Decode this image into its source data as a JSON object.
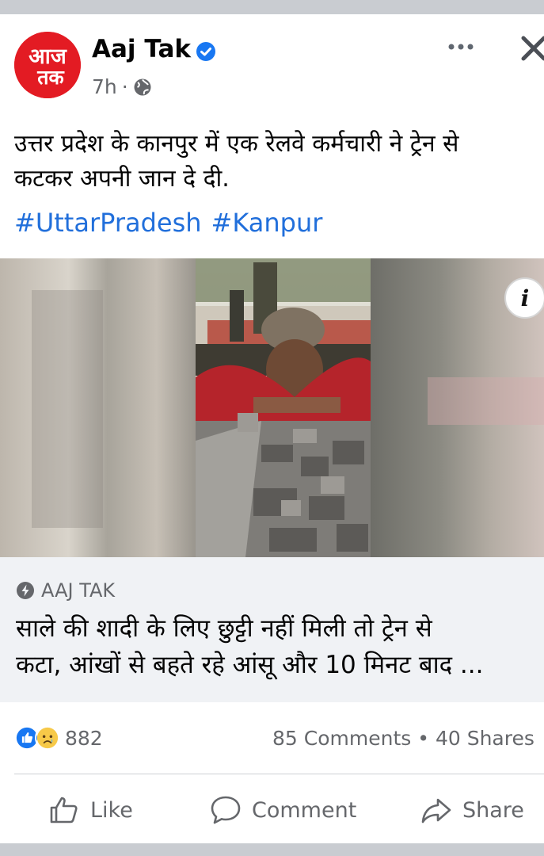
{
  "post": {
    "page_name": "Aaj Tak",
    "avatar_text_top": "आज",
    "avatar_text_bottom": "तक",
    "time": "7h",
    "separator": "·",
    "text_line1": "उत्तर प्रदेश के कानपुर में एक रेलवे कर्मचारी ने ट्रेन से",
    "text_line2": "कटकर अपनी जान दे दी.",
    "hashtags": [
      "#UttarPradesh",
      "#Kanpur"
    ],
    "info_label": "i"
  },
  "link": {
    "domain": "AAJ TAK",
    "title_line1": "साले की शादी के लिए छुट्टी नहीं मिली तो ट्रेन से",
    "title_line2": "कटा, आंखों से बहते रहे आंसू और 10 मिनट बाद ..."
  },
  "engagement": {
    "reaction_count": "882",
    "comments": "85 Comments",
    "dot": "•",
    "shares": "40 Shares"
  },
  "actions": {
    "like": "Like",
    "comment": "Comment",
    "share": "Share"
  },
  "colors": {
    "brand_red": "#e31b23",
    "link_blue": "#216fdb",
    "verified_blue": "#1877f2",
    "secondary_text": "#65676b"
  }
}
